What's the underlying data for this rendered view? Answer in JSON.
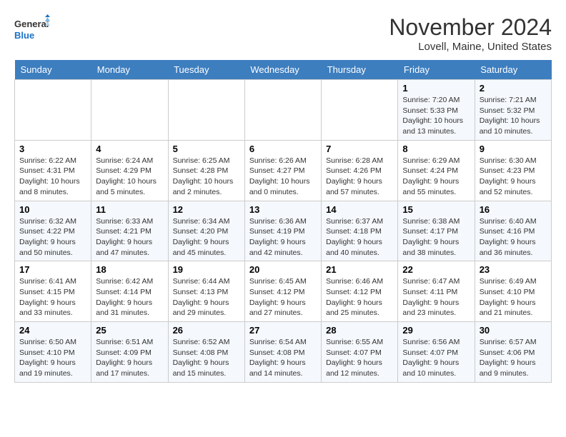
{
  "logo": {
    "text_general": "General",
    "text_blue": "Blue"
  },
  "title": "November 2024",
  "location": "Lovell, Maine, United States",
  "weekdays": [
    "Sunday",
    "Monday",
    "Tuesday",
    "Wednesday",
    "Thursday",
    "Friday",
    "Saturday"
  ],
  "weeks": [
    [
      {
        "day": "",
        "info": ""
      },
      {
        "day": "",
        "info": ""
      },
      {
        "day": "",
        "info": ""
      },
      {
        "day": "",
        "info": ""
      },
      {
        "day": "",
        "info": ""
      },
      {
        "day": "1",
        "info": "Sunrise: 7:20 AM\nSunset: 5:33 PM\nDaylight: 10 hours\nand 13 minutes."
      },
      {
        "day": "2",
        "info": "Sunrise: 7:21 AM\nSunset: 5:32 PM\nDaylight: 10 hours\nand 10 minutes."
      }
    ],
    [
      {
        "day": "3",
        "info": "Sunrise: 6:22 AM\nSunset: 4:31 PM\nDaylight: 10 hours\nand 8 minutes."
      },
      {
        "day": "4",
        "info": "Sunrise: 6:24 AM\nSunset: 4:29 PM\nDaylight: 10 hours\nand 5 minutes."
      },
      {
        "day": "5",
        "info": "Sunrise: 6:25 AM\nSunset: 4:28 PM\nDaylight: 10 hours\nand 2 minutes."
      },
      {
        "day": "6",
        "info": "Sunrise: 6:26 AM\nSunset: 4:27 PM\nDaylight: 10 hours\nand 0 minutes."
      },
      {
        "day": "7",
        "info": "Sunrise: 6:28 AM\nSunset: 4:26 PM\nDaylight: 9 hours\nand 57 minutes."
      },
      {
        "day": "8",
        "info": "Sunrise: 6:29 AM\nSunset: 4:24 PM\nDaylight: 9 hours\nand 55 minutes."
      },
      {
        "day": "9",
        "info": "Sunrise: 6:30 AM\nSunset: 4:23 PM\nDaylight: 9 hours\nand 52 minutes."
      }
    ],
    [
      {
        "day": "10",
        "info": "Sunrise: 6:32 AM\nSunset: 4:22 PM\nDaylight: 9 hours\nand 50 minutes."
      },
      {
        "day": "11",
        "info": "Sunrise: 6:33 AM\nSunset: 4:21 PM\nDaylight: 9 hours\nand 47 minutes."
      },
      {
        "day": "12",
        "info": "Sunrise: 6:34 AM\nSunset: 4:20 PM\nDaylight: 9 hours\nand 45 minutes."
      },
      {
        "day": "13",
        "info": "Sunrise: 6:36 AM\nSunset: 4:19 PM\nDaylight: 9 hours\nand 42 minutes."
      },
      {
        "day": "14",
        "info": "Sunrise: 6:37 AM\nSunset: 4:18 PM\nDaylight: 9 hours\nand 40 minutes."
      },
      {
        "day": "15",
        "info": "Sunrise: 6:38 AM\nSunset: 4:17 PM\nDaylight: 9 hours\nand 38 minutes."
      },
      {
        "day": "16",
        "info": "Sunrise: 6:40 AM\nSunset: 4:16 PM\nDaylight: 9 hours\nand 36 minutes."
      }
    ],
    [
      {
        "day": "17",
        "info": "Sunrise: 6:41 AM\nSunset: 4:15 PM\nDaylight: 9 hours\nand 33 minutes."
      },
      {
        "day": "18",
        "info": "Sunrise: 6:42 AM\nSunset: 4:14 PM\nDaylight: 9 hours\nand 31 minutes."
      },
      {
        "day": "19",
        "info": "Sunrise: 6:44 AM\nSunset: 4:13 PM\nDaylight: 9 hours\nand 29 minutes."
      },
      {
        "day": "20",
        "info": "Sunrise: 6:45 AM\nSunset: 4:12 PM\nDaylight: 9 hours\nand 27 minutes."
      },
      {
        "day": "21",
        "info": "Sunrise: 6:46 AM\nSunset: 4:12 PM\nDaylight: 9 hours\nand 25 minutes."
      },
      {
        "day": "22",
        "info": "Sunrise: 6:47 AM\nSunset: 4:11 PM\nDaylight: 9 hours\nand 23 minutes."
      },
      {
        "day": "23",
        "info": "Sunrise: 6:49 AM\nSunset: 4:10 PM\nDaylight: 9 hours\nand 21 minutes."
      }
    ],
    [
      {
        "day": "24",
        "info": "Sunrise: 6:50 AM\nSunset: 4:10 PM\nDaylight: 9 hours\nand 19 minutes."
      },
      {
        "day": "25",
        "info": "Sunrise: 6:51 AM\nSunset: 4:09 PM\nDaylight: 9 hours\nand 17 minutes."
      },
      {
        "day": "26",
        "info": "Sunrise: 6:52 AM\nSunset: 4:08 PM\nDaylight: 9 hours\nand 15 minutes."
      },
      {
        "day": "27",
        "info": "Sunrise: 6:54 AM\nSunset: 4:08 PM\nDaylight: 9 hours\nand 14 minutes."
      },
      {
        "day": "28",
        "info": "Sunrise: 6:55 AM\nSunset: 4:07 PM\nDaylight: 9 hours\nand 12 minutes."
      },
      {
        "day": "29",
        "info": "Sunrise: 6:56 AM\nSunset: 4:07 PM\nDaylight: 9 hours\nand 10 minutes."
      },
      {
        "day": "30",
        "info": "Sunrise: 6:57 AM\nSunset: 4:06 PM\nDaylight: 9 hours\nand 9 minutes."
      }
    ]
  ]
}
